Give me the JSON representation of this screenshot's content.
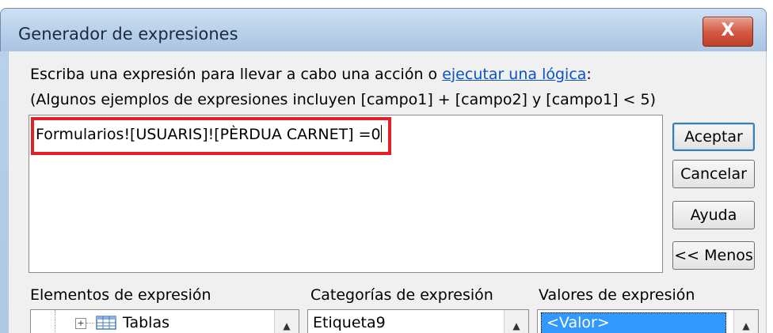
{
  "window": {
    "title": "Generador de expresiones",
    "close_label": "X"
  },
  "instructions": {
    "line1_prefix": "Escriba una expresión para llevar a cabo una acción o ",
    "line1_link": "ejecutar una lógica",
    "line1_suffix": ":",
    "line2": "(Algunos ejemplos de expresiones incluyen [campo1] + [campo2] y [campo1] < 5)"
  },
  "expression": {
    "value": "Formularios![USUARIS]![PÈRDUA CARNET] =0"
  },
  "buttons": {
    "ok": "Aceptar",
    "cancel": "Cancelar",
    "help": "Ayuda",
    "less": "<< Menos"
  },
  "panes": {
    "elements_label": "Elementos de expresión",
    "categories_label": "Categorías de expresión",
    "values_label": "Valores de expresión",
    "elements_item": "Tablas",
    "categories_item": "Etiqueta9",
    "values_item": "<Valor>"
  },
  "colors": {
    "highlight_border": "#e3202a",
    "selection": "#3399ff",
    "link": "#0a52c8"
  }
}
